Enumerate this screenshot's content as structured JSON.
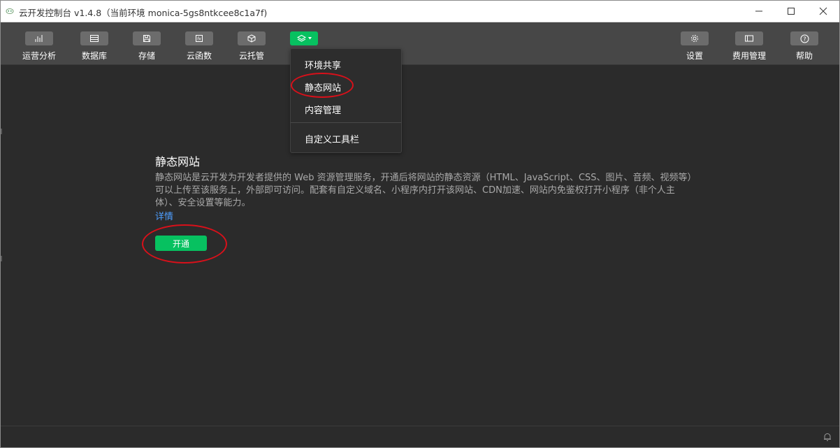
{
  "window": {
    "title": "云开发控制台 v1.4.8（当前环境 monica-5gs8ntkcee8c1a7f)"
  },
  "toolbar": {
    "left_items": [
      {
        "label": "运营分析",
        "icon": "bar-chart-icon"
      },
      {
        "label": "数据库",
        "icon": "database-icon"
      },
      {
        "label": "存储",
        "icon": "save-icon"
      },
      {
        "label": "云函数",
        "icon": "function-icon"
      },
      {
        "label": "云托管",
        "icon": "cube-icon"
      }
    ],
    "active_item": {
      "icon": "layers-icon"
    },
    "right_items": [
      {
        "label": "设置",
        "icon": "gear-icon"
      },
      {
        "label": "费用管理",
        "icon": "card-icon"
      },
      {
        "label": "帮助",
        "icon": "help-icon"
      }
    ]
  },
  "dropdown": {
    "items": [
      "环境共享",
      "静态网站",
      "内容管理"
    ],
    "footer_item": "自定义工具栏"
  },
  "main": {
    "title": "静态网站",
    "description": "静态网站是云开发为开发者提供的 Web 资源管理服务，开通后将网站的静态资源（HTML、JavaScript、CSS、图片、音频、视频等）可以上传至该服务上，外部即可访问。配套有自定义域名、小程序内打开该网站、CDN加速、网站内免鉴权打开小程序（非个人主体）、安全设置等能力。",
    "link": "详情",
    "button": "开通"
  },
  "colors": {
    "accent": "#07c160",
    "annotation": "#d9101a",
    "link": "#4e9eff"
  }
}
